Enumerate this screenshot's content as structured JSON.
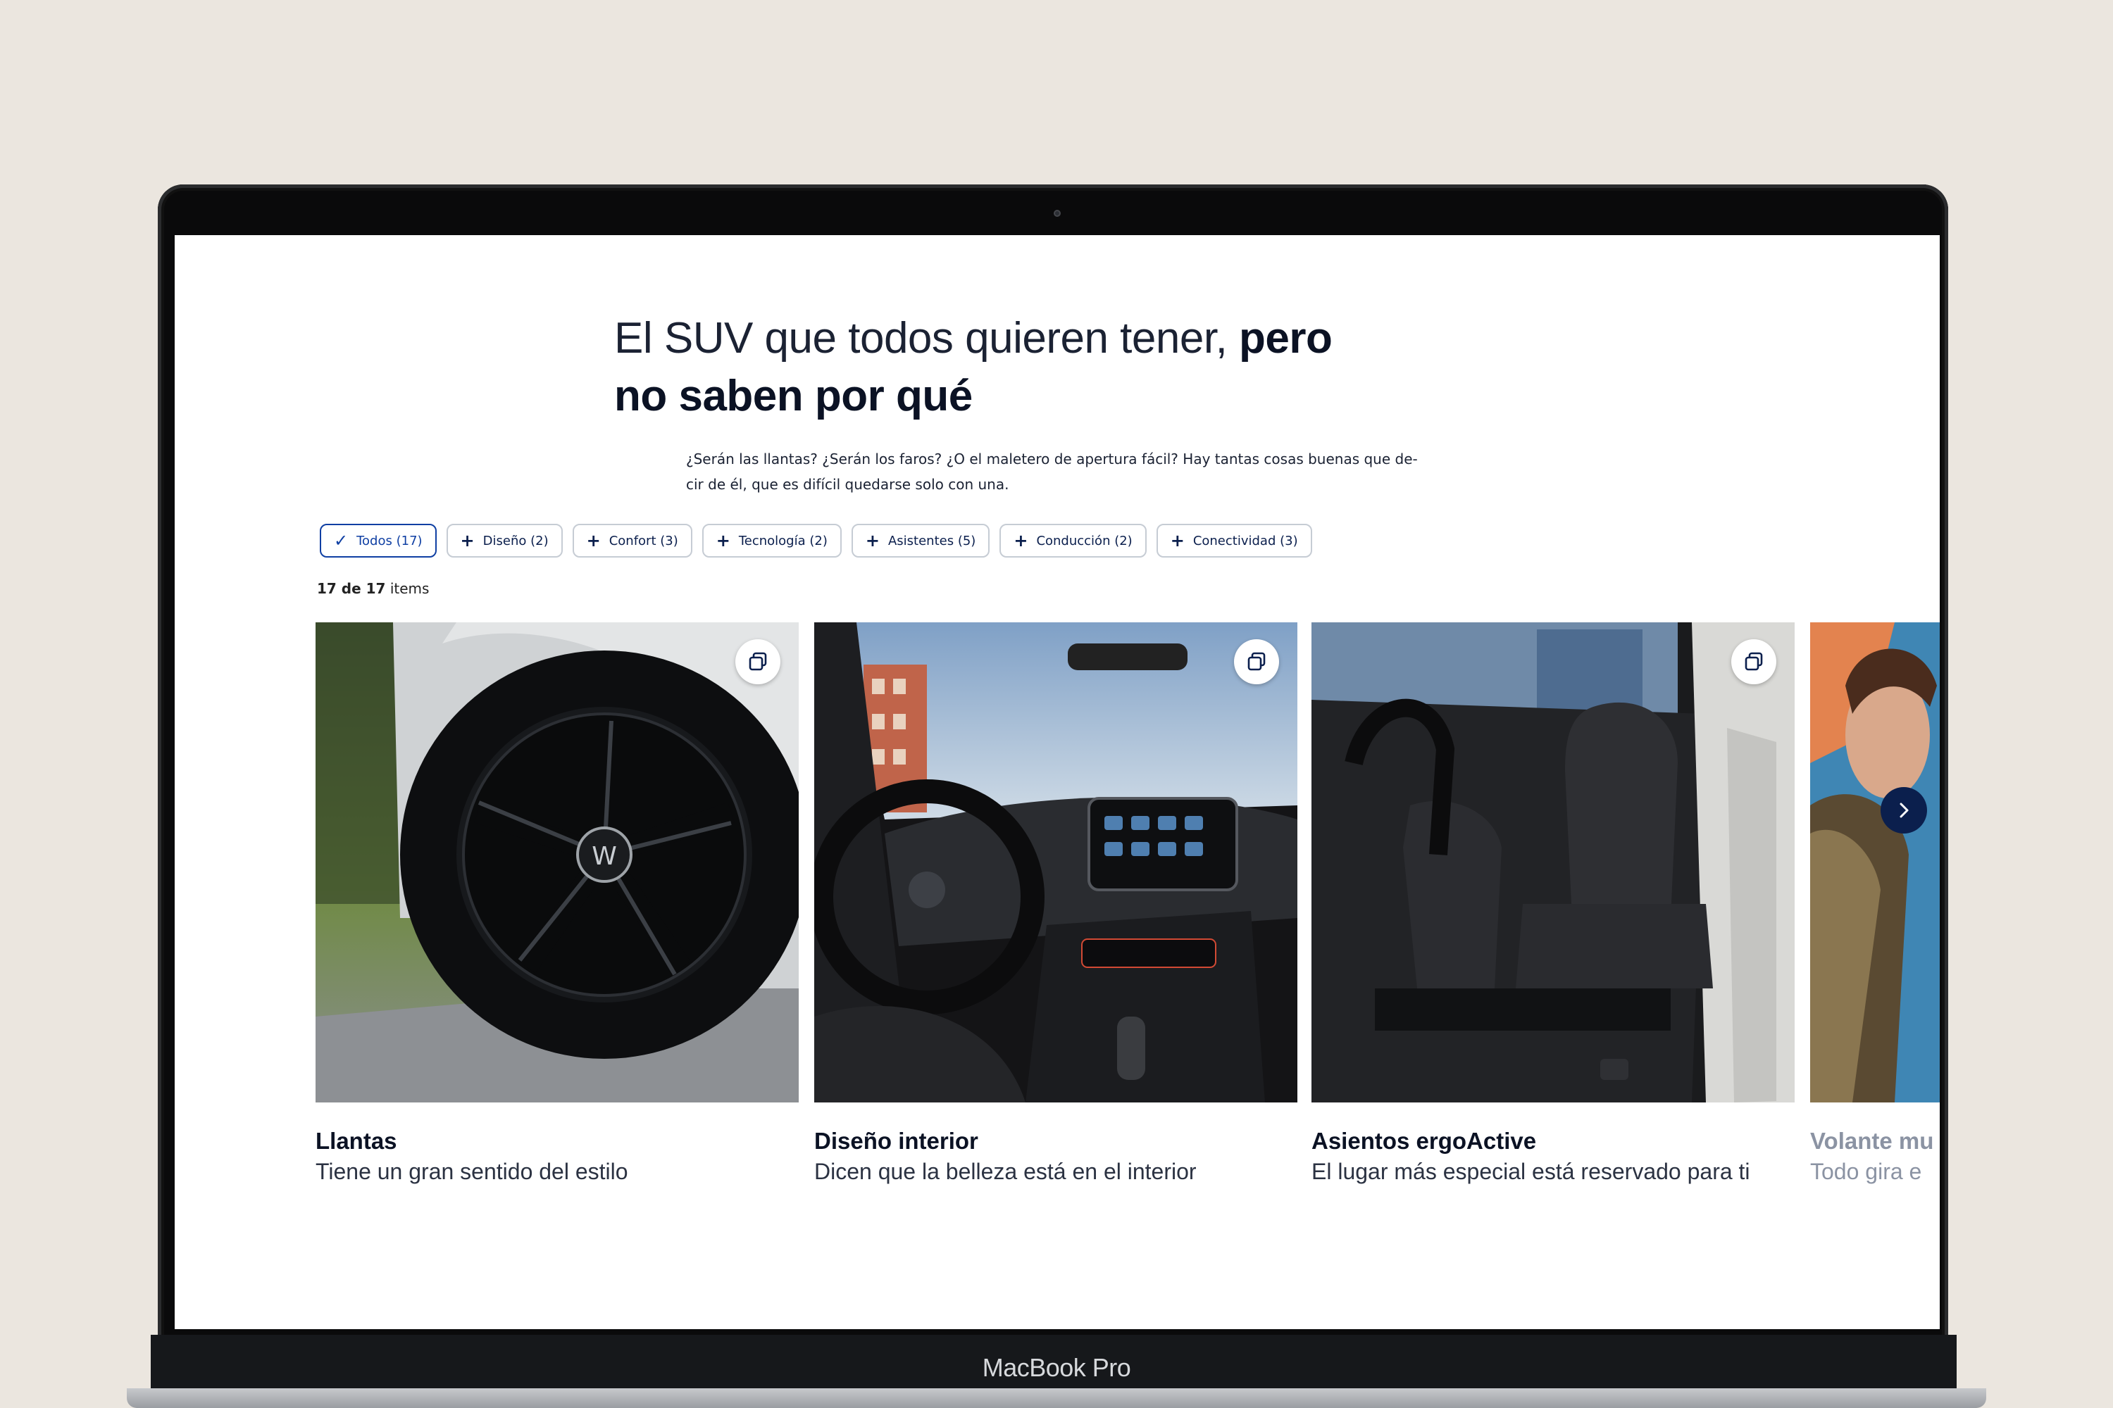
{
  "device": {
    "brand_label": "MacBook Pro"
  },
  "page": {
    "headline_regular": "El SUV que todos quieren tener, ",
    "headline_bold_1": "pero",
    "headline_bold_2": "no saben por qué",
    "intro_line_1": "¿Serán las llantas? ¿Serán los faros? ¿O el maletero de apertura fácil? Hay tantas cosas buenas que de-",
    "intro_line_2": "cir de él, que es difícil quedarse solo con una."
  },
  "filters": [
    {
      "label": "Todos (17)",
      "icon": "check-icon",
      "active": true
    },
    {
      "label": "Diseño (2)",
      "icon": "plus-icon",
      "active": false
    },
    {
      "label": "Confort (3)",
      "icon": "plus-icon",
      "active": false
    },
    {
      "label": "Tecnología (2)",
      "icon": "plus-icon",
      "active": false
    },
    {
      "label": "Asistentes (5)",
      "icon": "plus-icon",
      "active": false
    },
    {
      "label": "Conducción (2)",
      "icon": "plus-icon",
      "active": false
    },
    {
      "label": "Conectividad (3)",
      "icon": "plus-icon",
      "active": false
    }
  ],
  "results": {
    "shown": "17 de 17",
    "suffix": " items"
  },
  "cards": [
    {
      "title": "Llantas",
      "subtitle": "Tiene un gran sentido del estilo",
      "image": "wheel-photo"
    },
    {
      "title": "Diseño interior",
      "subtitle": "Dicen que la belleza está en el interior",
      "image": "dashboard-photo"
    },
    {
      "title": "Asientos ergoActive",
      "subtitle": "El lugar más especial está reservado para ti",
      "image": "seats-photo"
    },
    {
      "title": "Volante mu",
      "subtitle": "Todo gira e",
      "image": "person-photo"
    }
  ],
  "colors": {
    "accent": "#0f3fa3",
    "navy": "#0b1f4d",
    "background": "#ebe6df"
  }
}
